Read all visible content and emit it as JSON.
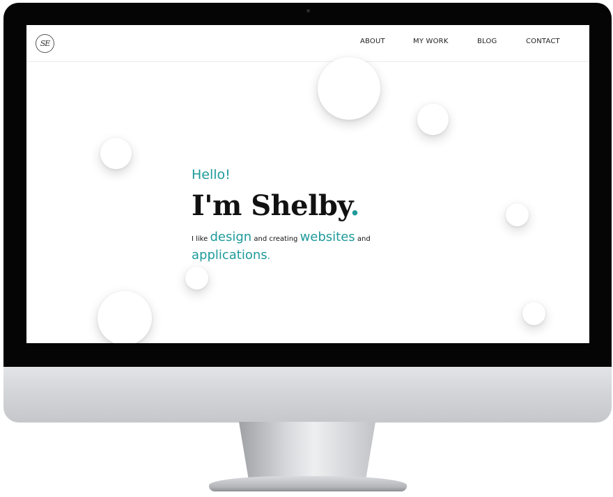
{
  "logo": {
    "text": "SE"
  },
  "nav": {
    "items": [
      {
        "label": "ABOUT"
      },
      {
        "label": "MY WORK"
      },
      {
        "label": "BLOG"
      },
      {
        "label": "CONTACT"
      }
    ]
  },
  "hero": {
    "greeting": "Hello!",
    "headline": "I'm Shelby",
    "headline_dot": ".",
    "tagline": {
      "part1": "I like ",
      "word1": "design",
      "part2": " and creating ",
      "word2": "websites",
      "part3": " and",
      "word3": "applications",
      "end": "."
    }
  },
  "colors": {
    "accent": "#1f9a9a",
    "text": "#111111",
    "background": "#ffffff",
    "bezel": "#050505"
  }
}
